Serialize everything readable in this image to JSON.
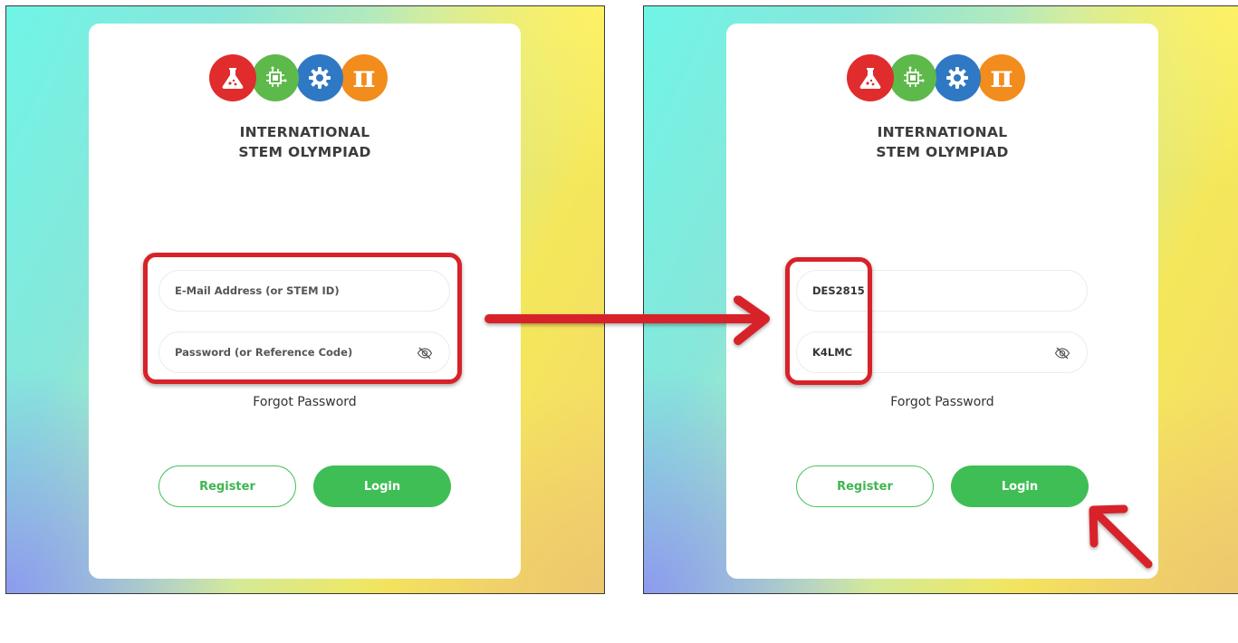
{
  "brand": {
    "name_line1": "INTERNATIONAL",
    "name_line2": "STEM OLYMPIAD",
    "logo_icons": [
      "flask-icon",
      "circuit-chip-icon",
      "gear-icon",
      "pi-icon"
    ],
    "logo_colors": [
      "#e02c2c",
      "#5db94a",
      "#2f78c4",
      "#f28c1c"
    ],
    "pi_glyph": "π"
  },
  "left_form": {
    "email_placeholder": "E-Mail Address (or STEM ID)",
    "password_placeholder": "Password (or Reference Code)",
    "forgot_label": "Forgot Password",
    "register_label": "Register",
    "login_label": "Login"
  },
  "right_form": {
    "email_value": "DES2815",
    "password_value": "K4LMC",
    "forgot_label": "Forgot Password",
    "register_label": "Register",
    "login_label": "Login"
  },
  "colors": {
    "accent_green": "#3fbe55",
    "annotation_red": "#d8222a"
  }
}
